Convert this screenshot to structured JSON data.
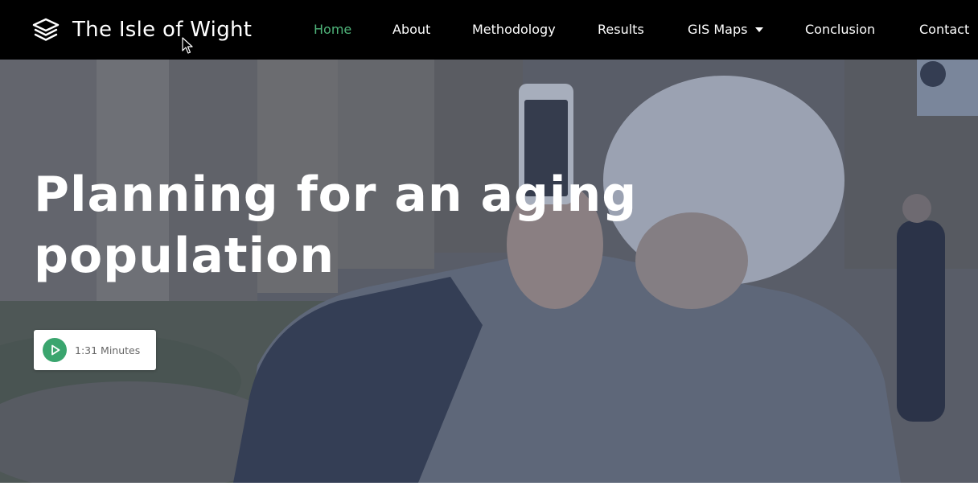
{
  "brand": {
    "title": "The Isle of Wight",
    "icon": "layers-icon"
  },
  "nav": {
    "items": [
      {
        "label": "Home",
        "active": true
      },
      {
        "label": "About"
      },
      {
        "label": "Methodology"
      },
      {
        "label": "Results"
      },
      {
        "label": "GIS Maps",
        "dropdown": true
      },
      {
        "label": "Conclusion"
      },
      {
        "label": "Contact"
      }
    ],
    "active_color": "#4fb47a"
  },
  "hero": {
    "title": "Planning for an aging population",
    "video_button": {
      "label": "1:31 Minutes",
      "icon": "play-icon",
      "accent": "#3aa56e"
    }
  },
  "colors": {
    "navbar_bg": "#000000",
    "text_light": "#ffffff"
  }
}
